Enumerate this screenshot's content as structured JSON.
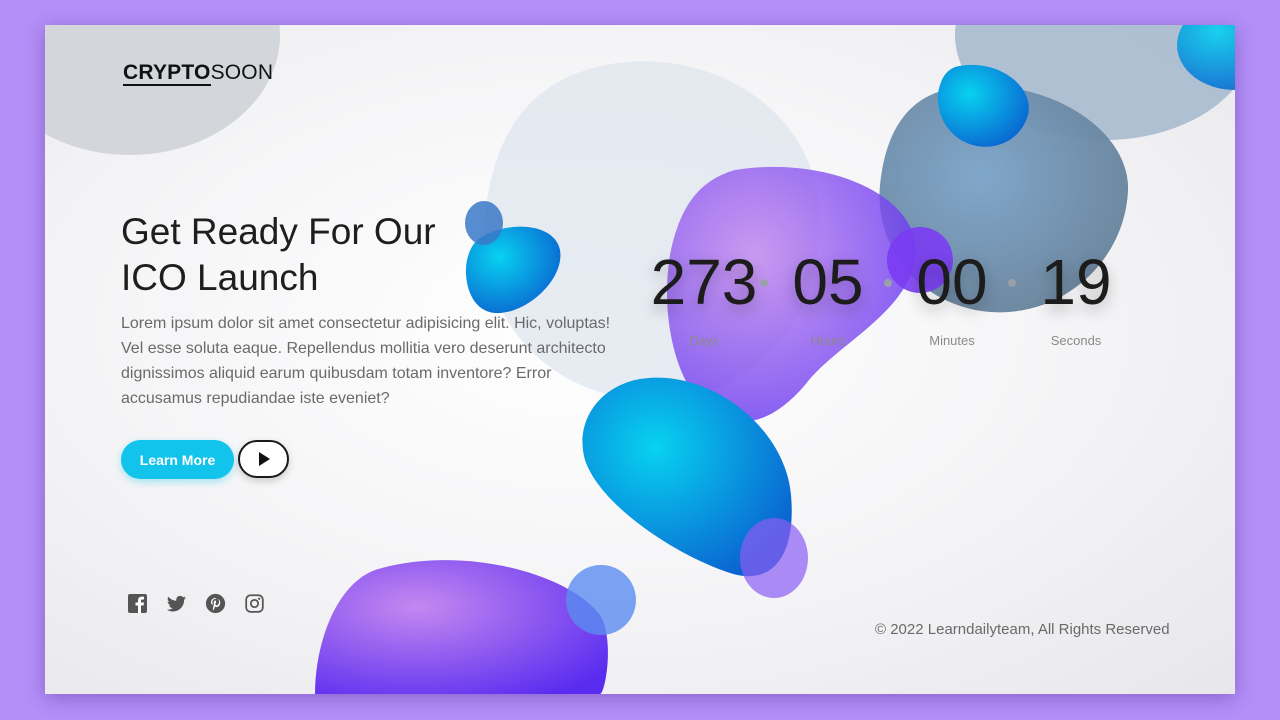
{
  "logo": {
    "bold": "CRYPTO",
    "regular": "SOON"
  },
  "hero": {
    "headline_line1": "Get Ready For Our",
    "headline_line2": "ICO Launch",
    "lead": "Lorem ipsum dolor sit amet consectetur adipisicing elit. Hic, voluptas! Vel esse soluta eaque. Repellendus mollitia vero deserunt architecto dignissimos aliquid earum quibusdam totam inventore? Error accusamus repudiandae iste eveniet?",
    "learn_more_label": "Learn More"
  },
  "countdown": {
    "days": {
      "value": "273",
      "label": "Days"
    },
    "hours": {
      "value": "05",
      "label": "Hours"
    },
    "minutes": {
      "value": "00",
      "label": "Minutes"
    },
    "seconds": {
      "value": "19",
      "label": "Seconds"
    }
  },
  "social": {
    "icons": [
      "facebook-icon",
      "twitter-icon",
      "pinterest-icon",
      "instagram-icon"
    ]
  },
  "footer": {
    "copyright": "© 2022 Learndailyteam, All Rights Reserved"
  },
  "colors": {
    "page_background": "#b38ff8",
    "accent_cyan": "#12c4ec",
    "blob_purple": "#8a4cf3",
    "blob_blue": "#0a7fd8",
    "text_dark": "#1e1e1e",
    "text_muted": "#6a6a6a"
  }
}
